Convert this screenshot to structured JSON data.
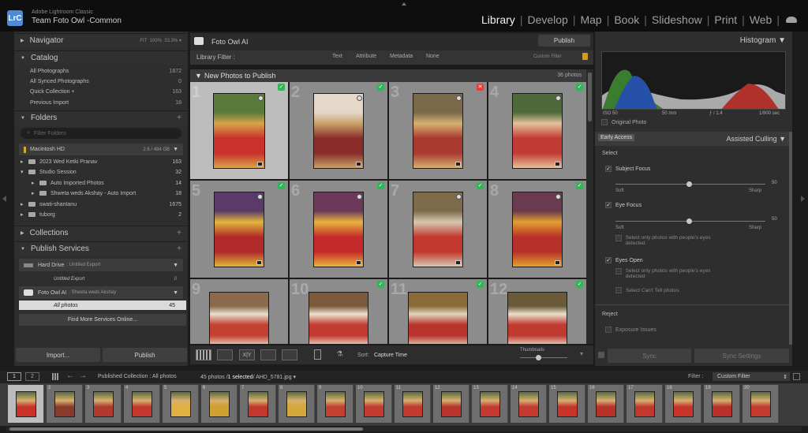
{
  "app": {
    "name": "Adobe Lightroom Classic",
    "catalog": "Team Foto Owl -Common",
    "logo": "LrC"
  },
  "modules": [
    "Library",
    "Develop",
    "Map",
    "Book",
    "Slideshow",
    "Print",
    "Web"
  ],
  "left": {
    "navigator": {
      "title": "Navigator",
      "fit": "FIT",
      "p100": "100%",
      "p333": "33.3%"
    },
    "catalog": {
      "title": "Catalog",
      "items": [
        {
          "label": "All Photographs",
          "count": "1872"
        },
        {
          "label": "All Synced Photographs",
          "count": "0"
        },
        {
          "label": "Quick Collection +",
          "count": "163"
        },
        {
          "label": "Previous Import",
          "count": "18"
        }
      ]
    },
    "folders": {
      "title": "Folders",
      "filter_placeholder": "Filter Folders",
      "drive": {
        "name": "Macintosh HD",
        "size": "2.6 / 494 GB"
      },
      "items": [
        {
          "label": "2023 Wed Ketki Pranav",
          "count": "163"
        },
        {
          "label": "Studio Session",
          "count": "32"
        },
        {
          "label": "Auto Imported Photos",
          "count": "14"
        },
        {
          "label": "Shweta weds Akshay - Auto Import",
          "count": "18"
        },
        {
          "label": "swati-shantanu",
          "count": "1675"
        },
        {
          "label": "tuborg",
          "count": "2"
        }
      ]
    },
    "collections": {
      "title": "Collections"
    },
    "publish": {
      "title": "Publish Services",
      "hard_drive": {
        "name": "Hard Drive",
        "sub": ":  Untitled Export"
      },
      "untitled": {
        "label": "Untitled Export",
        "count": "0"
      },
      "fotoowl": {
        "name": "Foto Owl AI",
        "sub": ":  Shweta weds Akshay"
      },
      "all_photos": {
        "label": "All photos",
        "count": "45"
      },
      "find_more": "Find More Services Online..."
    },
    "import_label": "Import...",
    "publish_label": "Publish"
  },
  "center": {
    "service_name": "Foto Owl AI",
    "publish_button": "Publish",
    "filter": {
      "title": "Library Filter :",
      "text": "Text",
      "attribute": "Attribute",
      "metadata": "Metadata",
      "none": "None",
      "custom": "Custom Filter"
    },
    "group": {
      "title": "New Photos to Publish",
      "count": "36 photos"
    },
    "cells": [
      "1",
      "2",
      "3",
      "4",
      "5",
      "6",
      "7",
      "8",
      "9",
      "10",
      "11",
      "12"
    ],
    "toolbar": {
      "sort_label": "Sort:",
      "sort_value": "Capture Time",
      "thumbs_label": "Thumbnails",
      "xy": "X|Y"
    }
  },
  "right": {
    "histogram": {
      "title": "Histogram",
      "iso": "ISO 50",
      "focal": "50 mm",
      "aperture": "ƒ / 1.4",
      "shutter": "1/800 sec",
      "original": "Original Photo"
    },
    "culling": {
      "early": "Early Access",
      "title": "Assisted Culling",
      "select": "Select",
      "subject_focus": "Subject Focus",
      "soft1": "Soft",
      "sharp1": "Sharp",
      "val1": "50",
      "eye_focus": "Eye Focus",
      "soft2": "Soft",
      "sharp2": "Sharp",
      "val2": "50",
      "select_people_1": "Select only photos with people's eyes detected",
      "eyes_open": "Eyes Open",
      "select_people_2": "Select only photos with people's eyes detected",
      "cant_tell": "Select Can't Tell photos",
      "reject": "Reject",
      "exposure": "Exposure Issues"
    },
    "sync": "Sync",
    "sync_settings": "Sync Settings"
  },
  "filmstrip": {
    "page1": "1",
    "page2": "2",
    "path": "Published Collection : All photos",
    "info": "45 photos /",
    "selected": "1 selected",
    "file": "/ AHD_5781.jpg",
    "filter_label": "Filter :",
    "filter_value": "Custom Filter",
    "thumbs": [
      "",
      "2",
      "3",
      "4",
      "5",
      "6",
      "7",
      "8",
      "9",
      "10",
      "11",
      "12",
      "13",
      "14",
      "15",
      "16",
      "17",
      "18",
      "19",
      "20"
    ]
  },
  "colors": {
    "accent": "#4f8ad6",
    "check": "#35b35a",
    "reject": "#e04040"
  }
}
